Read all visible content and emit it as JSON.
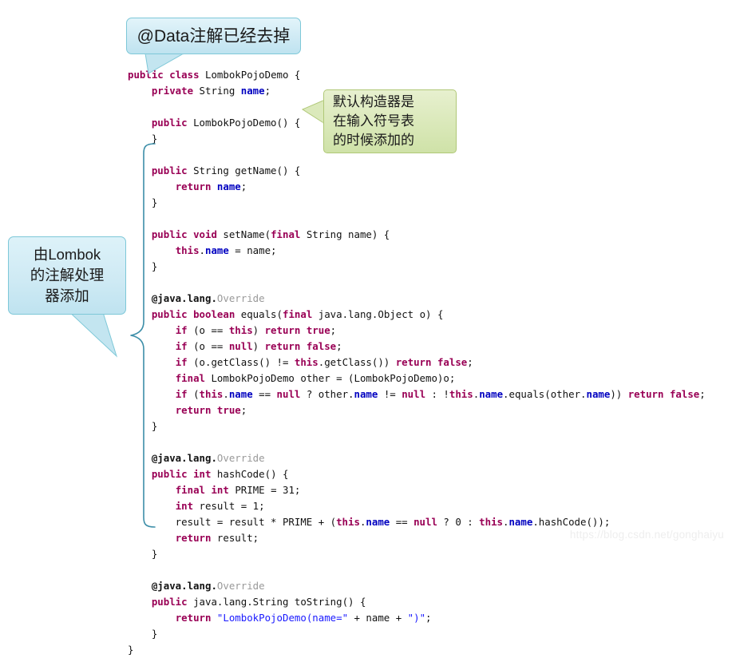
{
  "watermark": "https://blog.csdn.net/gonghaiyu",
  "colors": {
    "keyword": "#990055",
    "field": "#0000c0",
    "string": "#1a1aff",
    "annotation_gray": "#999999",
    "callout_blue_border": "#7ec8d8",
    "callout_blue_fill": "#cfeaf4",
    "callout_green_border": "#b0c877",
    "callout_green_fill": "#dbe9bb",
    "brace": "#3c8ea8",
    "text": "#111111"
  },
  "callouts": {
    "data_removed": {
      "text": "@Data注解已经去掉"
    },
    "default_ctor": {
      "lines": [
        "默认构造器是",
        "在输入符号表",
        "的时候添加的"
      ]
    },
    "lombok_processor": {
      "lines": [
        "由Lombok",
        "的注解处理",
        "器添加"
      ]
    }
  },
  "code": {
    "language": "java",
    "class_name": "LombokPojoDemo",
    "lines": [
      [
        {
          "t": "public",
          "c": "kw"
        },
        {
          "t": " ",
          "c": "plain"
        },
        {
          "t": "class",
          "c": "kw"
        },
        {
          "t": " LombokPojoDemo {",
          "c": "plain"
        }
      ],
      [
        {
          "t": "    ",
          "c": "plain"
        },
        {
          "t": "private",
          "c": "kw"
        },
        {
          "t": " String ",
          "c": "plain"
        },
        {
          "t": "name",
          "c": "fld"
        },
        {
          "t": ";",
          "c": "plain"
        }
      ],
      [],
      [
        {
          "t": "    ",
          "c": "plain"
        },
        {
          "t": "public",
          "c": "kw"
        },
        {
          "t": " LombokPojoDemo() {",
          "c": "plain"
        }
      ],
      [
        {
          "t": "    }",
          "c": "plain"
        }
      ],
      [],
      [
        {
          "t": "    ",
          "c": "plain"
        },
        {
          "t": "public",
          "c": "kw"
        },
        {
          "t": " String getName() {",
          "c": "plain"
        }
      ],
      [
        {
          "t": "        ",
          "c": "plain"
        },
        {
          "t": "return",
          "c": "kw"
        },
        {
          "t": " ",
          "c": "plain"
        },
        {
          "t": "name",
          "c": "fld"
        },
        {
          "t": ";",
          "c": "plain"
        }
      ],
      [
        {
          "t": "    }",
          "c": "plain"
        }
      ],
      [],
      [
        {
          "t": "    ",
          "c": "plain"
        },
        {
          "t": "public",
          "c": "kw"
        },
        {
          "t": " ",
          "c": "plain"
        },
        {
          "t": "void",
          "c": "kw"
        },
        {
          "t": " setName(",
          "c": "plain"
        },
        {
          "t": "final",
          "c": "kw"
        },
        {
          "t": " String name) {",
          "c": "plain"
        }
      ],
      [
        {
          "t": "        ",
          "c": "plain"
        },
        {
          "t": "this",
          "c": "kw"
        },
        {
          "t": ".",
          "c": "plain"
        },
        {
          "t": "name",
          "c": "fld"
        },
        {
          "t": " = name;",
          "c": "plain"
        }
      ],
      [
        {
          "t": "    }",
          "c": "plain"
        }
      ],
      [],
      [
        {
          "t": "    ",
          "c": "plain"
        },
        {
          "t": "@java.lang.",
          "c": "ann"
        },
        {
          "t": "Override",
          "c": "anng"
        }
      ],
      [
        {
          "t": "    ",
          "c": "plain"
        },
        {
          "t": "public",
          "c": "kw"
        },
        {
          "t": " ",
          "c": "plain"
        },
        {
          "t": "boolean",
          "c": "kw"
        },
        {
          "t": " equals(",
          "c": "plain"
        },
        {
          "t": "final",
          "c": "kw"
        },
        {
          "t": " java.lang.Object o) {",
          "c": "plain"
        }
      ],
      [
        {
          "t": "        ",
          "c": "plain"
        },
        {
          "t": "if",
          "c": "kw"
        },
        {
          "t": " (o == ",
          "c": "plain"
        },
        {
          "t": "this",
          "c": "kw"
        },
        {
          "t": ") ",
          "c": "plain"
        },
        {
          "t": "return",
          "c": "kw"
        },
        {
          "t": " ",
          "c": "plain"
        },
        {
          "t": "true",
          "c": "kw"
        },
        {
          "t": ";",
          "c": "plain"
        }
      ],
      [
        {
          "t": "        ",
          "c": "plain"
        },
        {
          "t": "if",
          "c": "kw"
        },
        {
          "t": " (o == ",
          "c": "plain"
        },
        {
          "t": "null",
          "c": "kw"
        },
        {
          "t": ") ",
          "c": "plain"
        },
        {
          "t": "return",
          "c": "kw"
        },
        {
          "t": " ",
          "c": "plain"
        },
        {
          "t": "false",
          "c": "kw"
        },
        {
          "t": ";",
          "c": "plain"
        }
      ],
      [
        {
          "t": "        ",
          "c": "plain"
        },
        {
          "t": "if",
          "c": "kw"
        },
        {
          "t": " (o.getClass() != ",
          "c": "plain"
        },
        {
          "t": "this",
          "c": "kw"
        },
        {
          "t": ".getClass()) ",
          "c": "plain"
        },
        {
          "t": "return",
          "c": "kw"
        },
        {
          "t": " ",
          "c": "plain"
        },
        {
          "t": "false",
          "c": "kw"
        },
        {
          "t": ";",
          "c": "plain"
        }
      ],
      [
        {
          "t": "        ",
          "c": "plain"
        },
        {
          "t": "final",
          "c": "kw"
        },
        {
          "t": " LombokPojoDemo other = (LombokPojoDemo)o;",
          "c": "plain"
        }
      ],
      [
        {
          "t": "        ",
          "c": "plain"
        },
        {
          "t": "if",
          "c": "kw"
        },
        {
          "t": " (",
          "c": "plain"
        },
        {
          "t": "this",
          "c": "kw"
        },
        {
          "t": ".",
          "c": "plain"
        },
        {
          "t": "name",
          "c": "fld"
        },
        {
          "t": " == ",
          "c": "plain"
        },
        {
          "t": "null",
          "c": "kw"
        },
        {
          "t": " ? other.",
          "c": "plain"
        },
        {
          "t": "name",
          "c": "fld"
        },
        {
          "t": " != ",
          "c": "plain"
        },
        {
          "t": "null",
          "c": "kw"
        },
        {
          "t": " : !",
          "c": "plain"
        },
        {
          "t": "this",
          "c": "kw"
        },
        {
          "t": ".",
          "c": "plain"
        },
        {
          "t": "name",
          "c": "fld"
        },
        {
          "t": ".equals(other.",
          "c": "plain"
        },
        {
          "t": "name",
          "c": "fld"
        },
        {
          "t": ")) ",
          "c": "plain"
        },
        {
          "t": "return",
          "c": "kw"
        },
        {
          "t": " ",
          "c": "plain"
        },
        {
          "t": "false",
          "c": "kw"
        },
        {
          "t": ";",
          "c": "plain"
        }
      ],
      [
        {
          "t": "        ",
          "c": "plain"
        },
        {
          "t": "return",
          "c": "kw"
        },
        {
          "t": " ",
          "c": "plain"
        },
        {
          "t": "true",
          "c": "kw"
        },
        {
          "t": ";",
          "c": "plain"
        }
      ],
      [
        {
          "t": "    }",
          "c": "plain"
        }
      ],
      [],
      [
        {
          "t": "    ",
          "c": "plain"
        },
        {
          "t": "@java.lang.",
          "c": "ann"
        },
        {
          "t": "Override",
          "c": "anng"
        }
      ],
      [
        {
          "t": "    ",
          "c": "plain"
        },
        {
          "t": "public",
          "c": "kw"
        },
        {
          "t": " ",
          "c": "plain"
        },
        {
          "t": "int",
          "c": "kw"
        },
        {
          "t": " hashCode() {",
          "c": "plain"
        }
      ],
      [
        {
          "t": "        ",
          "c": "plain"
        },
        {
          "t": "final",
          "c": "kw"
        },
        {
          "t": " ",
          "c": "plain"
        },
        {
          "t": "int",
          "c": "kw"
        },
        {
          "t": " PRIME = 31;",
          "c": "plain"
        }
      ],
      [
        {
          "t": "        ",
          "c": "plain"
        },
        {
          "t": "int",
          "c": "kw"
        },
        {
          "t": " result = 1;",
          "c": "plain"
        }
      ],
      [
        {
          "t": "        result = result * PRIME + (",
          "c": "plain"
        },
        {
          "t": "this",
          "c": "kw"
        },
        {
          "t": ".",
          "c": "plain"
        },
        {
          "t": "name",
          "c": "fld"
        },
        {
          "t": " == ",
          "c": "plain"
        },
        {
          "t": "null",
          "c": "kw"
        },
        {
          "t": " ? 0 : ",
          "c": "plain"
        },
        {
          "t": "this",
          "c": "kw"
        },
        {
          "t": ".",
          "c": "plain"
        },
        {
          "t": "name",
          "c": "fld"
        },
        {
          "t": ".hashCode());",
          "c": "plain"
        }
      ],
      [
        {
          "t": "        ",
          "c": "plain"
        },
        {
          "t": "return",
          "c": "kw"
        },
        {
          "t": " result;",
          "c": "plain"
        }
      ],
      [
        {
          "t": "    }",
          "c": "plain"
        }
      ],
      [],
      [
        {
          "t": "    ",
          "c": "plain"
        },
        {
          "t": "@java.lang.",
          "c": "ann"
        },
        {
          "t": "Override",
          "c": "anng"
        }
      ],
      [
        {
          "t": "    ",
          "c": "plain"
        },
        {
          "t": "public",
          "c": "kw"
        },
        {
          "t": " java.lang.String toString() {",
          "c": "plain"
        }
      ],
      [
        {
          "t": "        ",
          "c": "plain"
        },
        {
          "t": "return",
          "c": "kw"
        },
        {
          "t": " ",
          "c": "plain"
        },
        {
          "t": "\"LombokPojoDemo(name=\"",
          "c": "str"
        },
        {
          "t": " + name + ",
          "c": "plain"
        },
        {
          "t": "\")\"",
          "c": "str"
        },
        {
          "t": ";",
          "c": "plain"
        }
      ],
      [
        {
          "t": "    }",
          "c": "plain"
        }
      ],
      [
        {
          "t": "}",
          "c": "plain"
        }
      ]
    ]
  }
}
